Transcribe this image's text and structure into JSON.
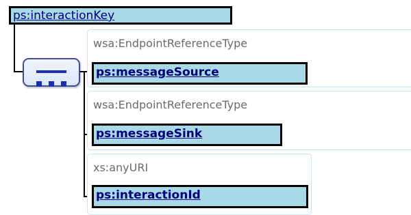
{
  "root": {
    "label": "ps:interactionKey"
  },
  "compositor": {
    "kind": "sequence"
  },
  "children": [
    {
      "type": "wsa:EndpointReferenceType",
      "label": "ps:messageSource"
    },
    {
      "type": "wsa:EndpointReferenceType",
      "label": "ps:messageSink"
    },
    {
      "type": "xs:anyURI",
      "label": "ps:interactionId"
    }
  ],
  "colors": {
    "element_fill": "#a9d9e7",
    "element_text": "#00007a",
    "type_text": "#6b6b6b",
    "sequence_border": "#3d4d9c",
    "sequence_glyph": "#1a2fb0"
  }
}
